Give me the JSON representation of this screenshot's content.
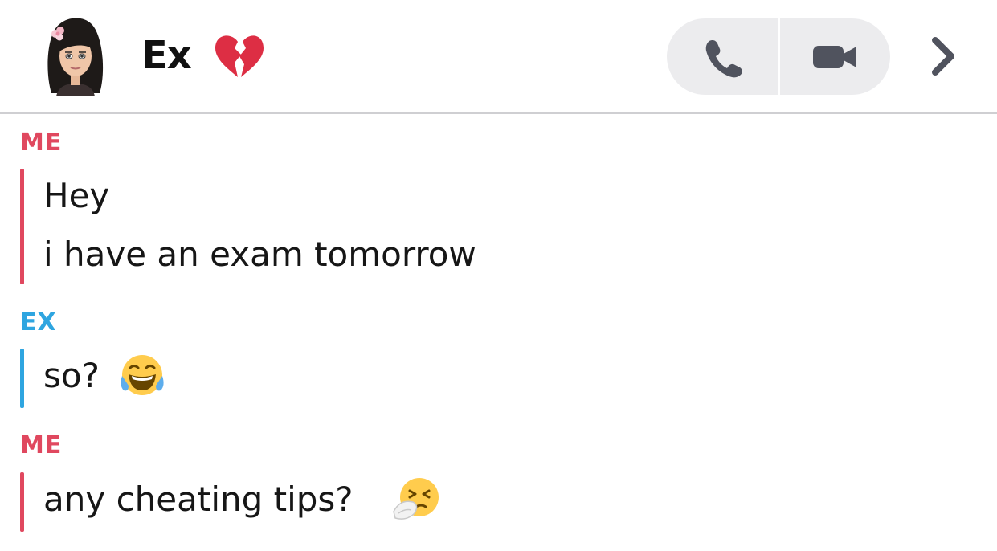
{
  "header": {
    "contact_name": "Ex",
    "heart_icon": "broken-heart-icon",
    "call_icon": "phone-icon",
    "video_icon": "video-camera-icon",
    "more_icon": "chevron-right-icon"
  },
  "colors": {
    "me": "#e0485f",
    "ex": "#2ea5e0",
    "button_bg": "#ececee",
    "icon": "#50535e"
  },
  "messages": [
    {
      "sender": "ME",
      "lines": [
        "Hey",
        "i have an exam tomorrow"
      ]
    },
    {
      "sender": "EX",
      "lines": [
        "so?"
      ],
      "emoji": "tears-of-joy-emoji"
    },
    {
      "sender": "ME",
      "lines": [
        "any cheating tips?"
      ],
      "emoji": "sneezing-face-emoji"
    }
  ]
}
